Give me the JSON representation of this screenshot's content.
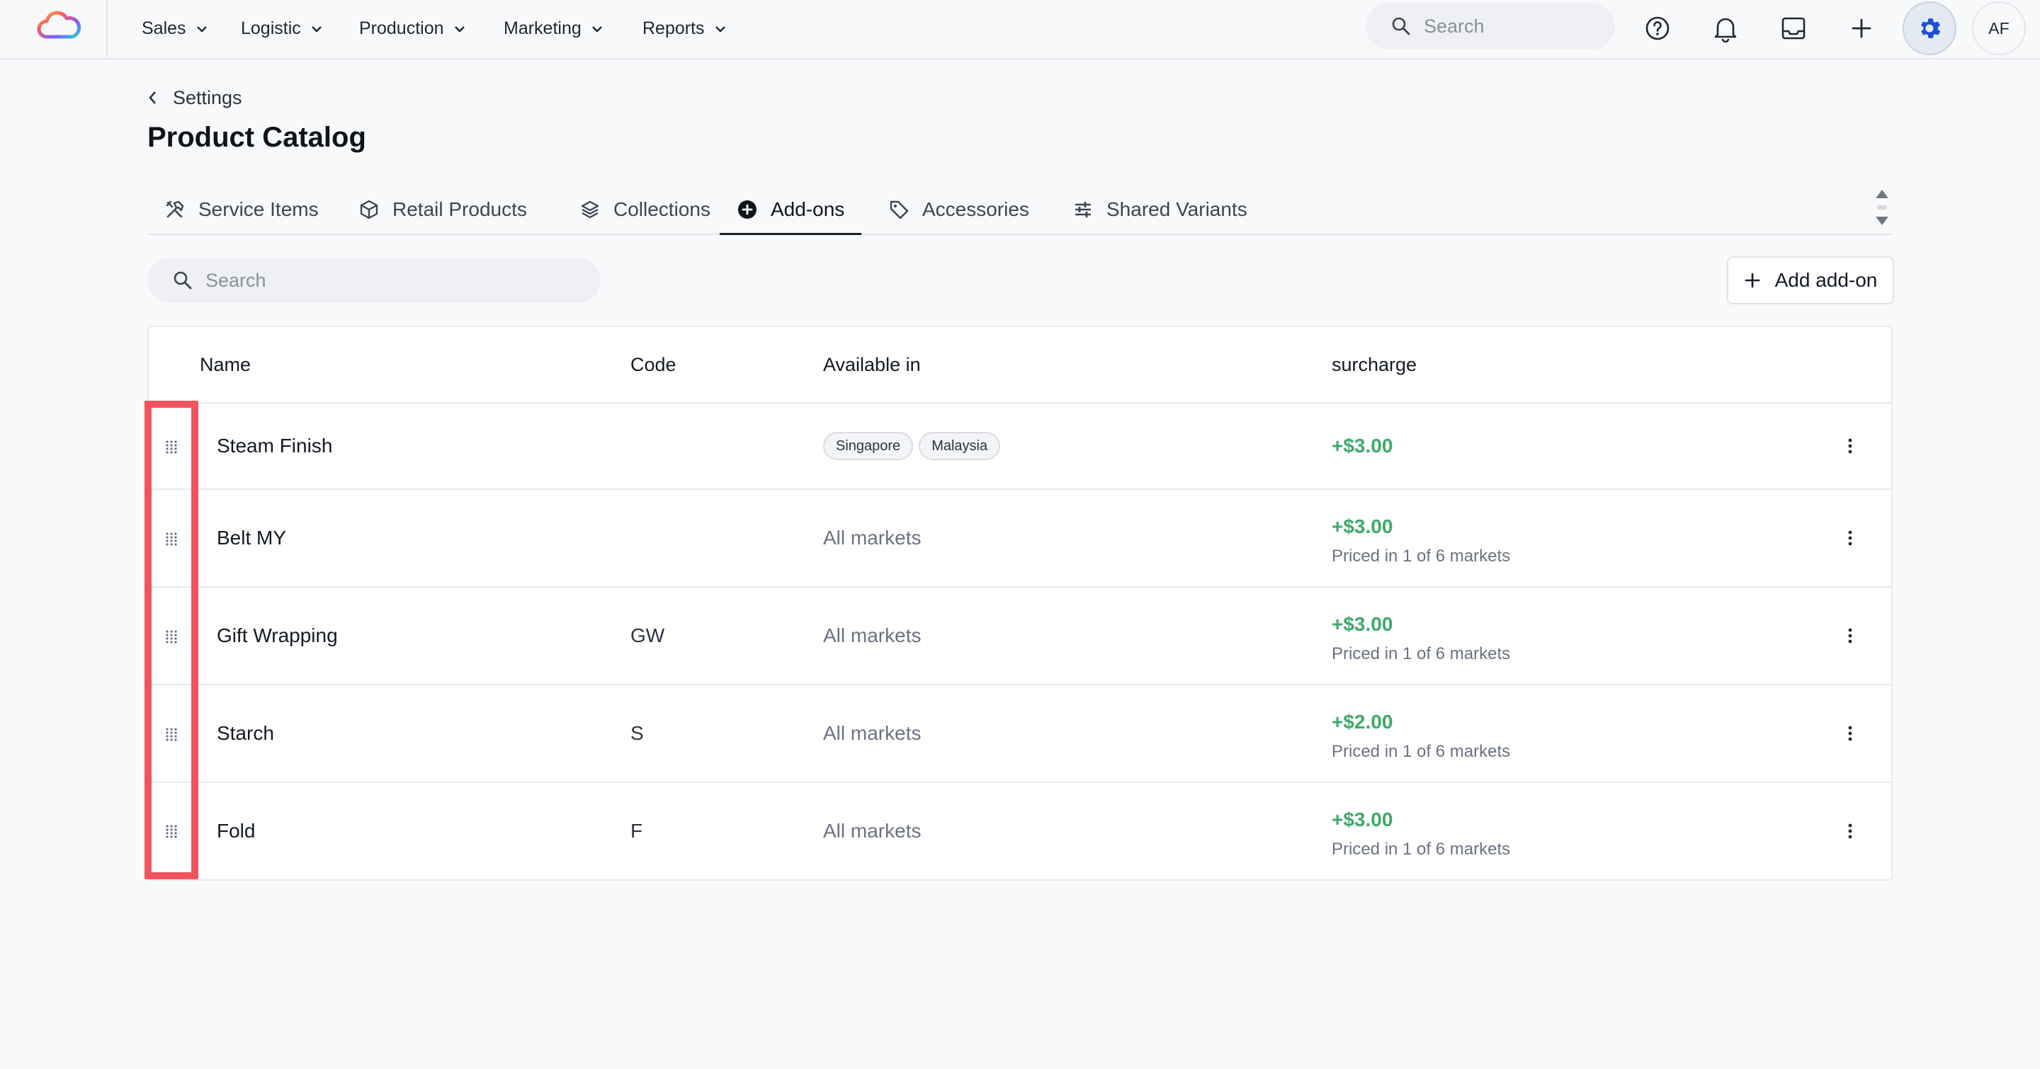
{
  "nav": {
    "items": [
      {
        "label": "Sales"
      },
      {
        "label": "Logistic"
      },
      {
        "label": "Production"
      },
      {
        "label": "Marketing"
      },
      {
        "label": "Reports"
      }
    ],
    "search_placeholder": "Search",
    "avatar_initials": "AF",
    "icons": [
      "help-circle-icon",
      "bell-icon",
      "inbox-icon",
      "plus-icon",
      "gear-icon"
    ]
  },
  "breadcrumb": {
    "label": "Settings"
  },
  "page": {
    "title": "Product Catalog"
  },
  "tabs": [
    {
      "label": "Service Items",
      "icon": "tools-icon"
    },
    {
      "label": "Retail Products",
      "icon": "box-icon"
    },
    {
      "label": "Collections",
      "icon": "layers-icon"
    },
    {
      "label": "Add-ons",
      "icon": "plus-circle-icon",
      "active": true
    },
    {
      "label": "Accessories",
      "icon": "tag-icon"
    },
    {
      "label": "Shared Variants",
      "icon": "sliders-icon"
    }
  ],
  "toolbar": {
    "search_placeholder": "Search",
    "add_label": "Add add-on"
  },
  "table": {
    "columns": {
      "name": "Name",
      "code": "Code",
      "available": "Available in",
      "surcharge": "surcharge"
    },
    "rows": [
      {
        "name": "Steam Finish",
        "code": "",
        "markets": [
          "Singapore",
          "Malaysia"
        ],
        "surcharge": "+$3.00",
        "priced": ""
      },
      {
        "name": "Belt MY",
        "code": "",
        "available": "All markets",
        "surcharge": "+$3.00",
        "priced": "Priced in 1 of 6 markets"
      },
      {
        "name": "Gift Wrapping",
        "code": "GW",
        "available": "All markets",
        "surcharge": "+$3.00",
        "priced": "Priced in 1 of 6 markets"
      },
      {
        "name": "Starch",
        "code": "S",
        "available": "All markets",
        "surcharge": "+$2.00",
        "priced": "Priced in 1 of 6 markets"
      },
      {
        "name": "Fold",
        "code": "F",
        "available": "All markets",
        "surcharge": "+$3.00",
        "priced": "Priced in 1 of 6 markets"
      }
    ]
  },
  "colors": {
    "accent_green": "#3eaa6a",
    "highlight": "#f0545e",
    "gear_active": "#1d4ed8"
  }
}
